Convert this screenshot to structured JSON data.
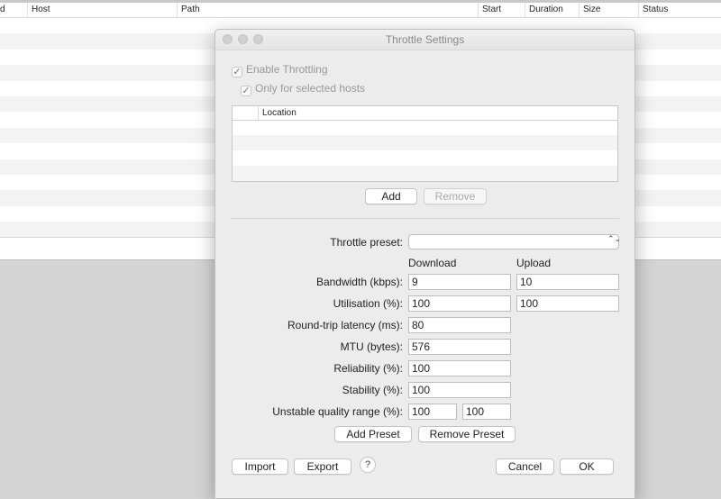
{
  "background_table": {
    "columns": [
      "d",
      "Host",
      "Path",
      "Start",
      "Duration",
      "Size",
      "Status"
    ]
  },
  "dialog": {
    "title": "Throttle Settings",
    "enable_throttling": {
      "label": "Enable Throttling",
      "checked": true
    },
    "only_selected_hosts": {
      "label": "Only for selected hosts",
      "checked": true
    },
    "location_table": {
      "header": "Location"
    },
    "buttons": {
      "add": "Add",
      "remove": "Remove",
      "add_preset": "Add Preset",
      "remove_preset": "Remove Preset",
      "import": "Import",
      "export": "Export",
      "help": "?",
      "cancel": "Cancel",
      "ok": "OK"
    },
    "check_glyph": "✓",
    "select_glyph": "⌃⌄",
    "throttle_preset": {
      "label": "Throttle preset:",
      "value": ""
    },
    "columns": {
      "download": "Download",
      "upload": "Upload"
    },
    "fields": {
      "bandwidth": {
        "label": "Bandwidth (kbps):",
        "download": "9",
        "upload": "10"
      },
      "utilisation": {
        "label": "Utilisation (%):",
        "download": "100",
        "upload": "100"
      },
      "latency": {
        "label": "Round-trip latency (ms):",
        "value": "80"
      },
      "mtu": {
        "label": "MTU (bytes):",
        "value": "576"
      },
      "reliability": {
        "label": "Reliability (%):",
        "value": "100"
      },
      "stability": {
        "label": "Stability (%):",
        "value": "100"
      },
      "unstable_range": {
        "label": "Unstable quality range (%):",
        "min": "100",
        "max": "100"
      }
    }
  }
}
